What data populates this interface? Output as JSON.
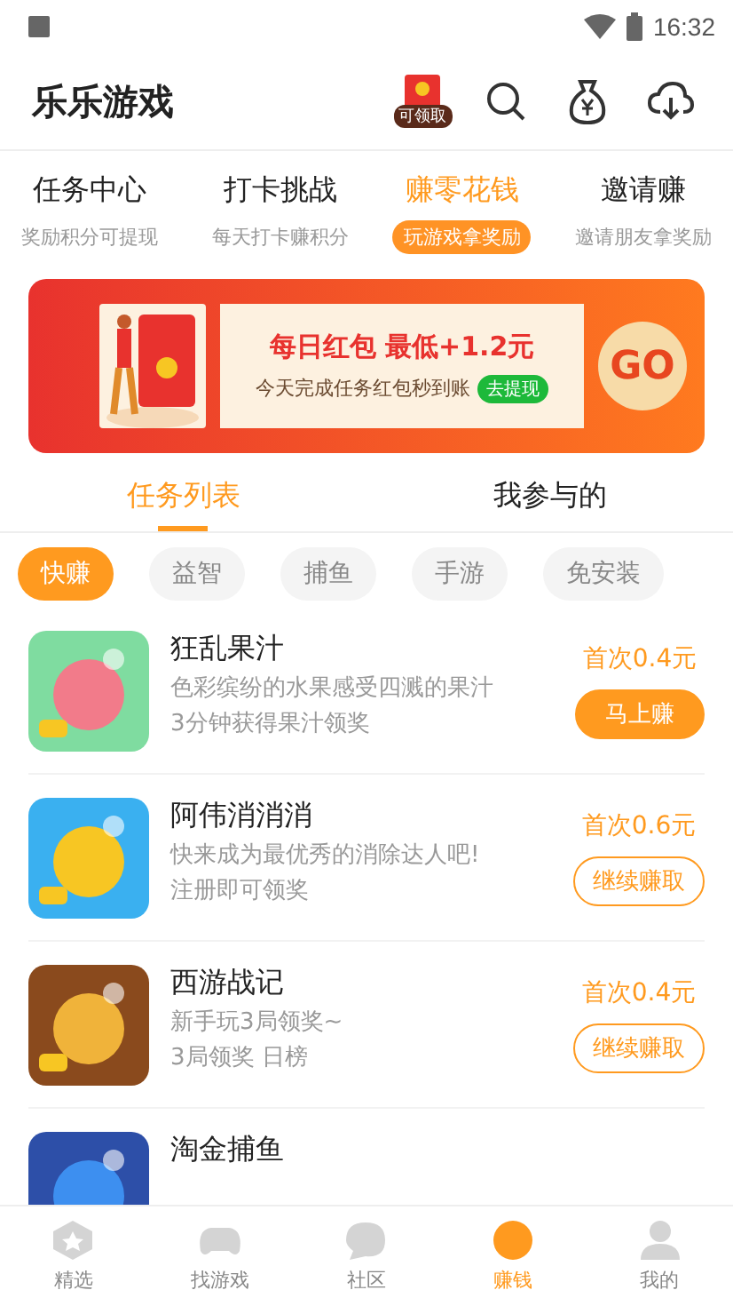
{
  "status_bar": {
    "time": "16:32"
  },
  "header": {
    "title": "乐乐游戏",
    "redpacket_badge": "可领取"
  },
  "top_tabs": [
    {
      "label": "任务中心",
      "sub": "奖励积分可提现",
      "selected": false
    },
    {
      "label": "打卡挑战",
      "sub": "每天打卡赚积分",
      "selected": false
    },
    {
      "label": "赚零花钱",
      "sub": "玩游戏拿奖励",
      "selected": true
    },
    {
      "label": "邀请赚",
      "sub": "邀请朋友拿奖励",
      "selected": false
    }
  ],
  "banner": {
    "headline": "每日红包 最低+1.2元",
    "subline": "今天完成任务红包秒到账",
    "pill": "去提现",
    "go": "GO"
  },
  "list_tabs": [
    {
      "label": "任务列表",
      "selected": true
    },
    {
      "label": "我参与的",
      "selected": false
    }
  ],
  "chips": [
    {
      "label": "快赚",
      "selected": true
    },
    {
      "label": "益智",
      "selected": false
    },
    {
      "label": "捕鱼",
      "selected": false
    },
    {
      "label": "手游",
      "selected": false
    },
    {
      "label": "免安装",
      "selected": false
    }
  ],
  "games": [
    {
      "title": "狂乱果汁",
      "desc": "色彩缤纷的水果感受四溅的果汁",
      "note": "3分钟获得果汁领奖",
      "price": "首次0.4元",
      "action": "马上赚",
      "kind": "filled"
    },
    {
      "title": "阿伟消消消",
      "desc": "快来成为最优秀的消除达人吧!",
      "note": "注册即可领奖",
      "price": "首次0.6元",
      "action": "继续赚取",
      "kind": "outline"
    },
    {
      "title": "西游战记",
      "desc": "新手玩3局领奖~",
      "note": "3局领奖 日榜",
      "price": "首次0.4元",
      "action": "继续赚取",
      "kind": "outline"
    },
    {
      "title": "淘金捕鱼"
    }
  ],
  "bottom_nav": [
    {
      "label": "精选",
      "selected": false
    },
    {
      "label": "找游戏",
      "selected": false
    },
    {
      "label": "社区",
      "selected": false
    },
    {
      "label": "赚钱",
      "selected": true
    },
    {
      "label": "我的",
      "selected": false
    }
  ]
}
